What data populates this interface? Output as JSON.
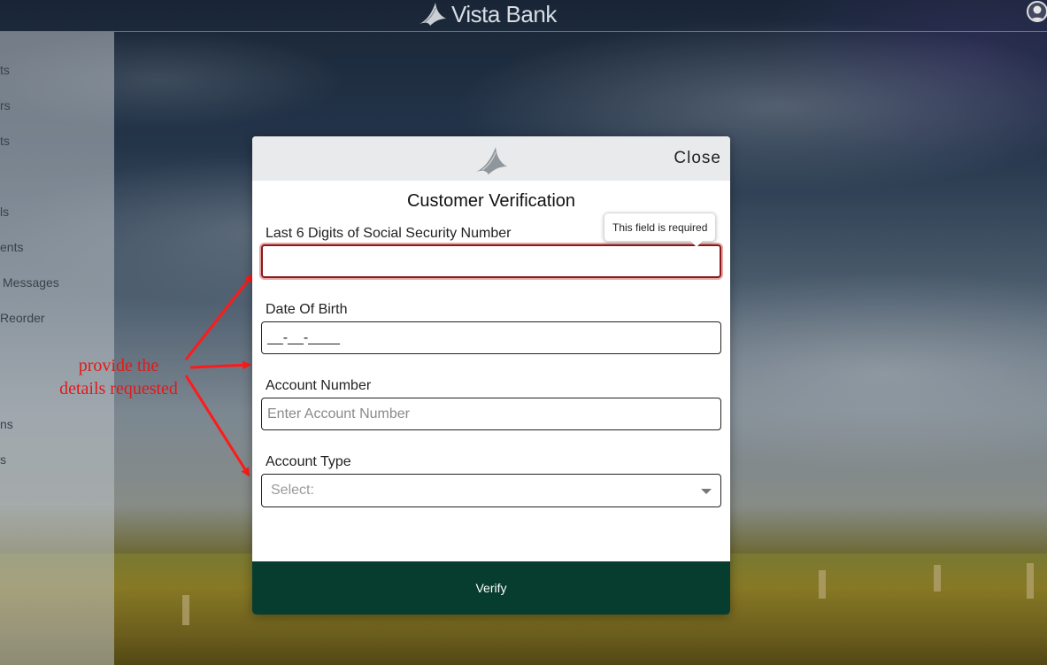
{
  "header": {
    "brand_name": "Vista Bank",
    "logo_icon": "eagle-icon",
    "profile_icon": "user-profile-icon"
  },
  "sidebar": {
    "items": [
      {
        "label": "ts"
      },
      {
        "label": "rs"
      },
      {
        "label": "ts"
      },
      {
        "label": "ls"
      },
      {
        "label": "ents"
      },
      {
        "label": "Messages"
      },
      {
        "label": "Reorder"
      },
      {
        "label": "ns"
      },
      {
        "label": "s"
      }
    ]
  },
  "annotation": {
    "text_line1": "provide the",
    "text_line2": "details requested",
    "color": "#e01a1a"
  },
  "modal": {
    "close_label": "Close",
    "title": "Customer Verification",
    "ssn": {
      "label": "Last 6 Digits of Social Security Number",
      "value": "",
      "error_tooltip": "This field is required"
    },
    "dob": {
      "label": "Date Of Birth",
      "value": "__-__-____"
    },
    "account_number": {
      "label": "Account Number",
      "placeholder": "Enter Account Number"
    },
    "account_type": {
      "label": "Account Type",
      "selected": "Select:"
    },
    "verify_label": "Verify",
    "verify_color": "#073d2e",
    "error_color": "#8b1a1a"
  }
}
